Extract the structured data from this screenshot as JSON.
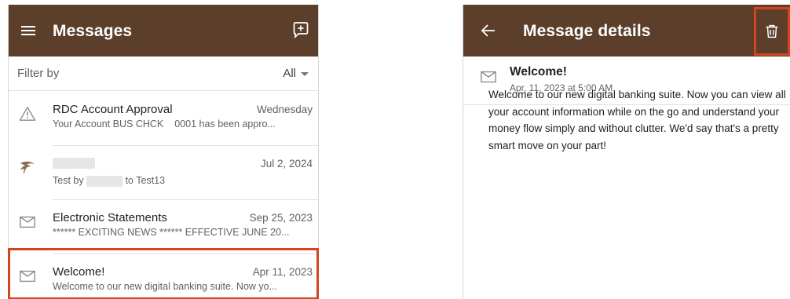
{
  "messages_screen": {
    "title": "Messages",
    "filter_label": "Filter by",
    "filter_value": "All",
    "items": [
      {
        "title": "RDC Account Approval",
        "date": "Wednesday",
        "preview_a": "Your Account BUS CHCK",
        "preview_b": "0001 has been appro...",
        "icon": "warning-icon"
      },
      {
        "title": "",
        "date": "Jul 2, 2024",
        "preview_a": "Test by",
        "preview_b": "to Test13",
        "icon": "eagle-logo-icon"
      },
      {
        "title": "Electronic Statements",
        "date": "Sep 25, 2023",
        "preview": "****** EXCITING NEWS ****** EFFECTIVE JUNE 20...",
        "icon": "mail-icon"
      },
      {
        "title": "Welcome!",
        "date": "Apr 11, 2023",
        "preview": "Welcome to our new digital banking suite. Now yo...",
        "icon": "mail-icon"
      }
    ]
  },
  "details_screen": {
    "title": "Message details",
    "subject": "Welcome!",
    "date": "Apr, 11, 2023 at 5:00 AM",
    "body": "Welcome to our new digital banking suite. Now you can view all your account information while on the go and understand your money flow simply and without clutter. We'd say that's a pretty smart move on your part!"
  },
  "colors": {
    "appbar": "#5c3f2b",
    "highlight": "#d4451f"
  }
}
